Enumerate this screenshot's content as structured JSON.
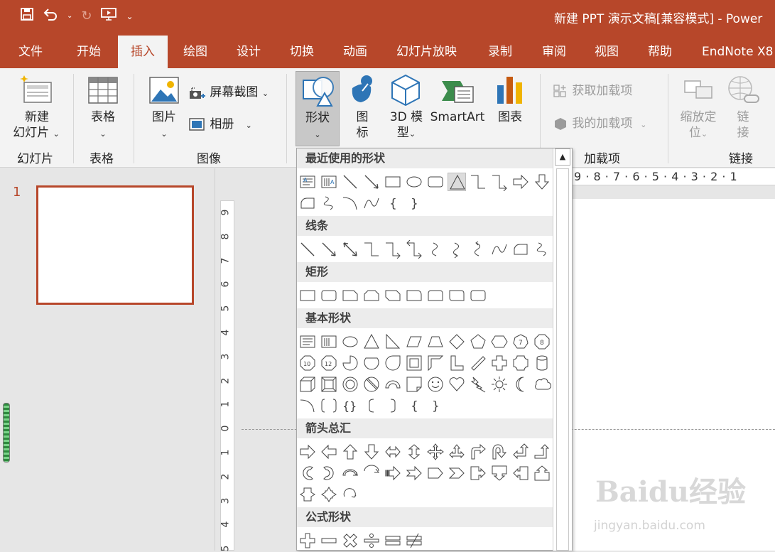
{
  "window": {
    "title": "新建 PPT 演示文稿[兼容模式]  -  Power"
  },
  "tabs": [
    {
      "label": "文件"
    },
    {
      "label": "开始"
    },
    {
      "label": "插入"
    },
    {
      "label": "绘图"
    },
    {
      "label": "设计"
    },
    {
      "label": "切换"
    },
    {
      "label": "动画"
    },
    {
      "label": "幻灯片放映"
    },
    {
      "label": "录制"
    },
    {
      "label": "审阅"
    },
    {
      "label": "视图"
    },
    {
      "label": "帮助"
    },
    {
      "label": "EndNote X8"
    }
  ],
  "active_tab": "插入",
  "ribbon": {
    "new_slide_l1": "新建",
    "new_slide_l2": "幻灯片",
    "table": "表格",
    "picture": "图片",
    "screenshot": "屏幕截图",
    "album": "相册",
    "shapes": "形状",
    "icons_l1": "图",
    "icons_l2": "标",
    "model3d_l1": "3D 模",
    "model3d_l2": "型",
    "smartart": "SmartArt",
    "chart": "图表",
    "get_addins": "获取加载项",
    "my_addins": "我的加载项",
    "zoom_l1": "缩放定",
    "zoom_l2": "位",
    "link_l1": "链",
    "link_l2": "接",
    "groups": {
      "slides": "幻灯片",
      "tables": "表格",
      "images": "图像",
      "addins": "加载项",
      "links": "链接"
    },
    "dropdown_caret": "⌄"
  },
  "slides_pane": {
    "slide_number": "1"
  },
  "vertical_ruler": [
    "9",
    "8",
    "7",
    "6",
    "5",
    "4",
    "3",
    "2",
    "1",
    "0",
    "1",
    "2",
    "3",
    "4",
    "5"
  ],
  "horizontal_ruler": "9 · 8 · 7 · 6 · 5 · 4 · 3 · 2 · 1",
  "shape_gallery": {
    "categories": {
      "recent": "最近使用的形状",
      "lines": "线条",
      "rectangles": "矩形",
      "basic": "基本形状",
      "arrows": "箭头总汇",
      "equation": "公式形状"
    },
    "scroll_up": "▲"
  },
  "watermark": {
    "brand": "Baidu经验",
    "url": "jingyan.baidu.com"
  },
  "colors": {
    "accent": "#b7472a",
    "ribbon_bg": "#f3f3f3",
    "workspace": "#e6e6e6"
  }
}
